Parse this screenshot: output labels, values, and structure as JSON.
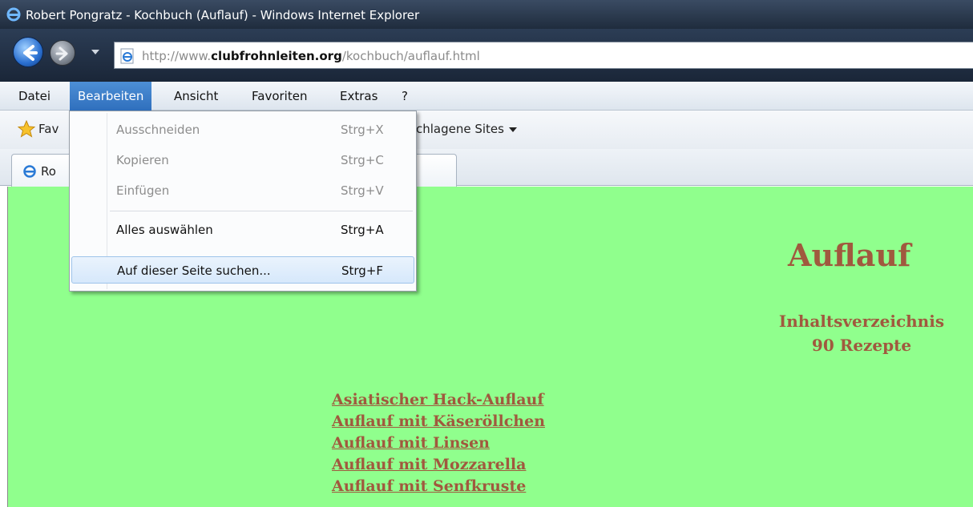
{
  "window": {
    "title": "Robert Pongratz - Kochbuch (Auflauf) - Windows Internet Explorer"
  },
  "address_bar": {
    "url_prefix": "http://www.",
    "url_domain": "clubfrohnleiten.org",
    "url_path": "/kochbuch/auflauf.html"
  },
  "menu_bar": {
    "items": [
      "Datei",
      "Bearbeiten",
      "Ansicht",
      "Favoriten",
      "Extras",
      "?"
    ],
    "active": "Bearbeiten"
  },
  "favorites_bar": {
    "favorites_label": "Fav",
    "suggested_sites": "chlagene Sites"
  },
  "tab": {
    "title": "Ro"
  },
  "edit_menu": {
    "items": [
      {
        "label": "Ausschneiden",
        "shortcut": "Strg+X",
        "enabled": false
      },
      {
        "label": "Kopieren",
        "shortcut": "Strg+C",
        "enabled": false
      },
      {
        "label": "Einfügen",
        "shortcut": "Strg+V",
        "enabled": false
      },
      {
        "label": "Alles auswählen",
        "shortcut": "Strg+A",
        "enabled": true
      },
      {
        "label": "Auf dieser Seite suchen...",
        "shortcut": "Strg+F",
        "enabled": true,
        "highlighted": true
      }
    ]
  },
  "page": {
    "title": "Auflauf",
    "toc_label": "Inhaltsverzeichnis",
    "recipe_count": "90 Rezepte",
    "recipes": [
      "Asiatischer Hack-Auflauf",
      "Auflauf mit Käseröllchen",
      "Auflauf mit Linsen",
      "Auflauf mit Mozzarella",
      "Auflauf mit Senfkruste"
    ]
  },
  "colors": {
    "page_background": "#90ff8d",
    "page_text": "#a0593e",
    "menu_highlight": "#2f6fbd"
  }
}
